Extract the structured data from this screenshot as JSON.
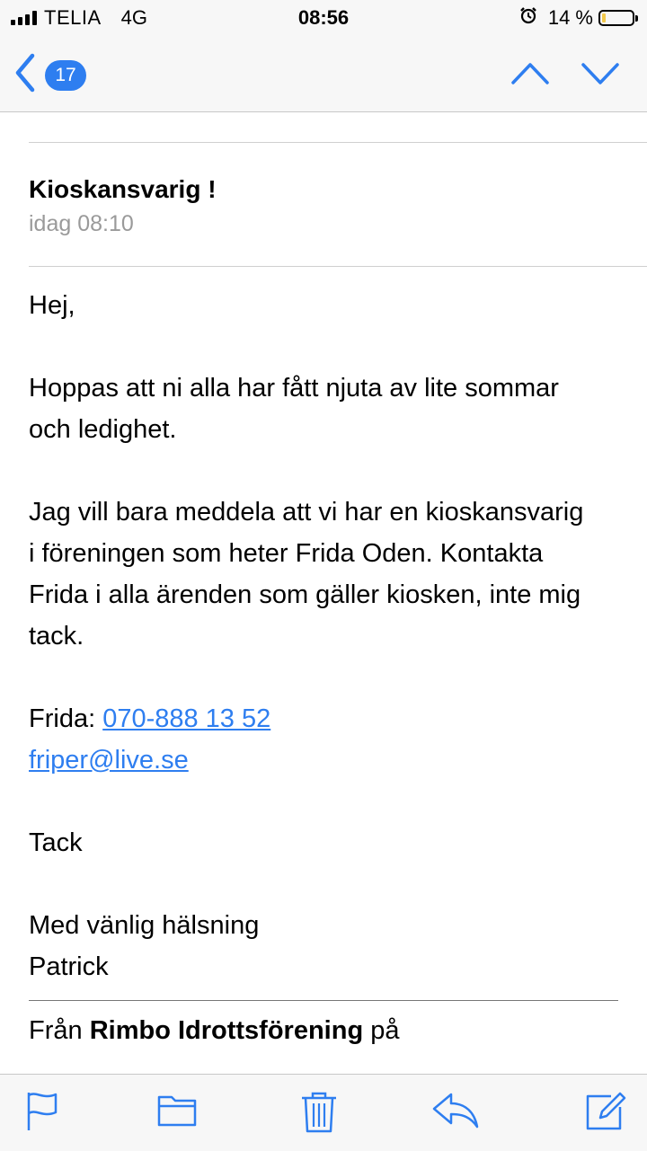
{
  "status_bar": {
    "carrier": "TELIA",
    "network": "4G",
    "time": "08:56",
    "battery_percent": "14 %",
    "battery_level": 0.14
  },
  "nav": {
    "badge_count": "17",
    "icons": [
      "chevron-left-icon",
      "chevron-up-icon",
      "chevron-down-icon"
    ]
  },
  "message": {
    "subject": "Kioskansvarig !",
    "date": "idag 08:10",
    "greeting": "Hej,",
    "para1": "Hoppas att ni alla har fått njuta av lite sommar och ledighet.",
    "para2": "Jag vill bara meddela att vi har en kioskansvarig i föreningen som heter Frida Oden. Kontakta Frida i alla ärenden som gäller kiosken, inte mig tack.",
    "contact_label": "Frida: ",
    "phone": "070-888 13 52",
    "email": "friper@live.se",
    "thanks": "Tack",
    "closing": "Med vänlig hälsning",
    "signature": "Patrick",
    "footer_prefix": "Från ",
    "footer_org": "Rimbo Idrottsförening",
    "footer_suffix": " på"
  },
  "toolbar": {
    "icons": [
      "flag-icon",
      "folder-icon",
      "trash-icon",
      "reply-icon",
      "compose-icon"
    ]
  },
  "colors": {
    "accent": "#2e7ef0",
    "bar_background": "#f7f7f7",
    "secondary_text": "#9a9a9a"
  }
}
